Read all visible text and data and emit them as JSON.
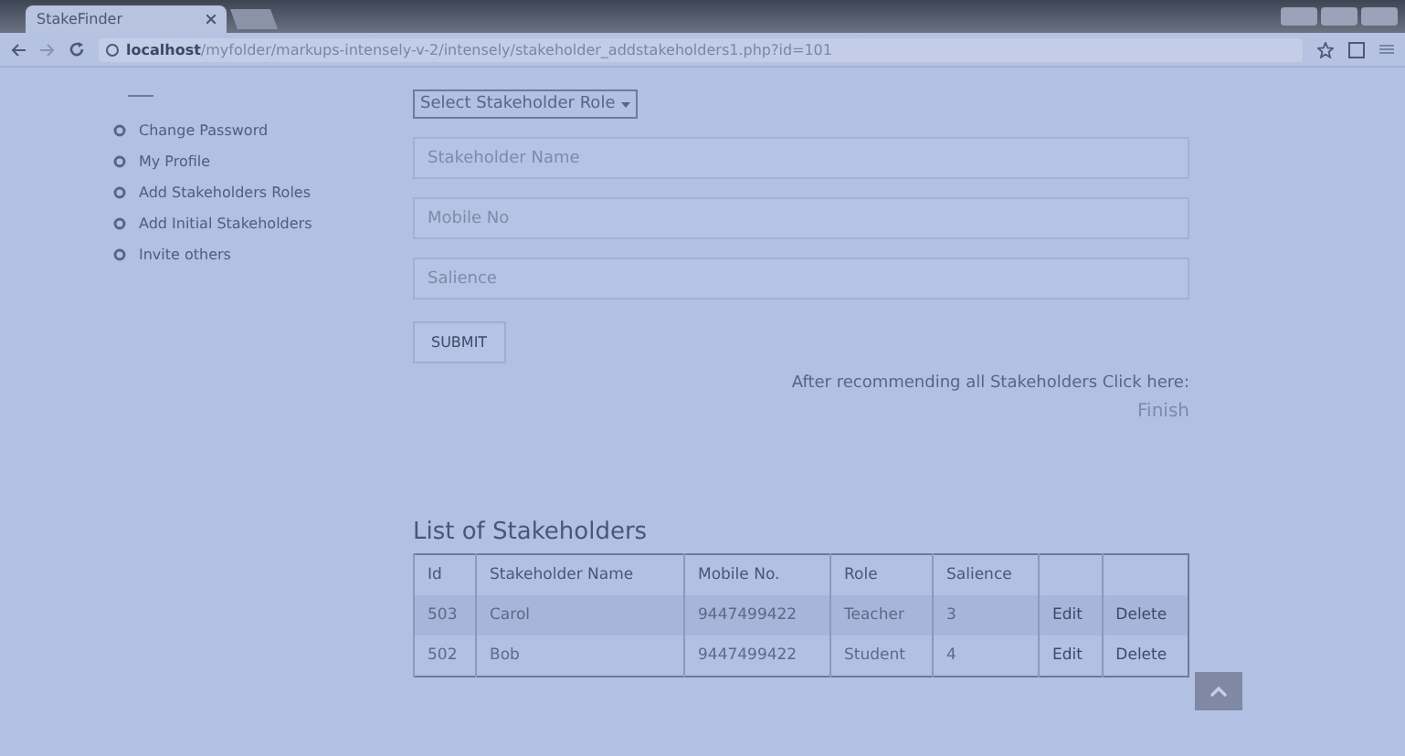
{
  "browser": {
    "tab_title": "StakeFinder",
    "url_host": "localhost",
    "url_path": "/myfolder/markups-intensely-v-2/intensely/stakeholder_addstakeholders1.php?id=101"
  },
  "sidebar": {
    "items": [
      {
        "label": "Change Password"
      },
      {
        "label": "My Profile"
      },
      {
        "label": "Add Stakeholders Roles"
      },
      {
        "label": "Add Initial Stakeholders"
      },
      {
        "label": "Invite others"
      }
    ]
  },
  "form": {
    "role_select": "Select Stakeholder Role",
    "fields": [
      {
        "placeholder": "Stakeholder Name"
      },
      {
        "placeholder": "Mobile No"
      },
      {
        "placeholder": "Salience"
      }
    ],
    "submit": "SUBMIT",
    "note": "After recommending all Stakeholders Click here:",
    "finish_link": "Finish"
  },
  "table": {
    "title": "List of Stakeholders",
    "columns": [
      "Id",
      "Stakeholder Name",
      "Mobile No.",
      "Role",
      "Salience"
    ],
    "rows": [
      {
        "cells": [
          "503",
          "Carol",
          "9447499422",
          "Teacher",
          "3"
        ],
        "actions": [
          "Edit",
          "Delete"
        ]
      },
      {
        "cells": [
          "502",
          "Bob",
          "9447499422",
          "Student",
          "4"
        ],
        "actions": [
          "Edit",
          "Delete"
        ]
      }
    ]
  }
}
